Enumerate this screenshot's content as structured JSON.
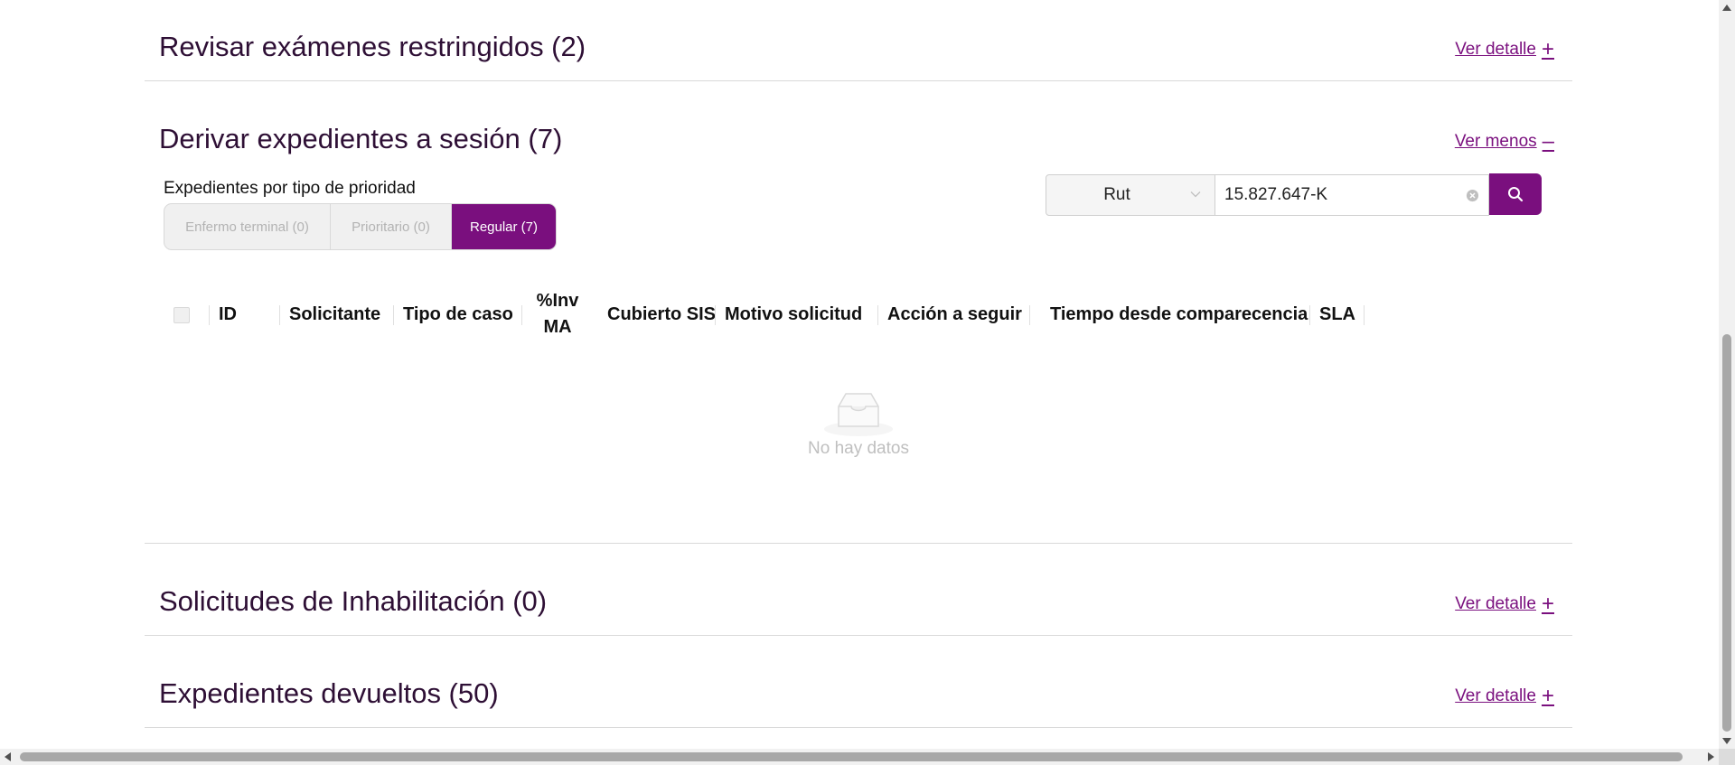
{
  "sections": {
    "restricted_exams": {
      "title": "Revisar exámenes restringidos (2)",
      "link_label": "Ver detalle",
      "link_sign": "+"
    },
    "derive_files": {
      "title": "Derivar expedientes a sesión (7)",
      "link_label": "Ver menos",
      "link_sign": "–",
      "priority_label": "Expedientes por tipo de prioridad",
      "priority_tabs": [
        {
          "label": "Enfermo terminal (0)",
          "active": false
        },
        {
          "label": "Prioritario (0)",
          "active": false
        },
        {
          "label": "Regular (7)",
          "active": true
        }
      ],
      "search": {
        "select_value": "Rut",
        "input_value": "15.827.647-K"
      },
      "table": {
        "headers": {
          "id": "ID",
          "solicitante": "Solicitante",
          "tipo_caso": "Tipo de caso",
          "inv_ma_line1": "%Inv",
          "inv_ma_line2": "MA",
          "cubierto_sis": "Cubierto SIS",
          "motivo": "Motivo solicitud",
          "accion": "Acción a seguir",
          "tiempo": "Tiempo desde comparecencia",
          "sla": "SLA"
        },
        "empty_text": "No hay datos"
      }
    },
    "inhabilitation": {
      "title": "Solicitudes de Inhabilitación (0)",
      "link_label": "Ver detalle",
      "link_sign": "+"
    },
    "returned_files": {
      "title": "Expedientes devueltos (50)",
      "link_label": "Ver detalle",
      "link_sign": "+"
    }
  },
  "colors": {
    "brand": "#7a0f7e",
    "title": "#2e0f35",
    "muted": "#bfbfbf"
  },
  "icons": {
    "search": "search-icon",
    "clear": "close-circle-icon",
    "chevron": "chevron-down-icon",
    "empty": "empty-inbox-icon"
  }
}
